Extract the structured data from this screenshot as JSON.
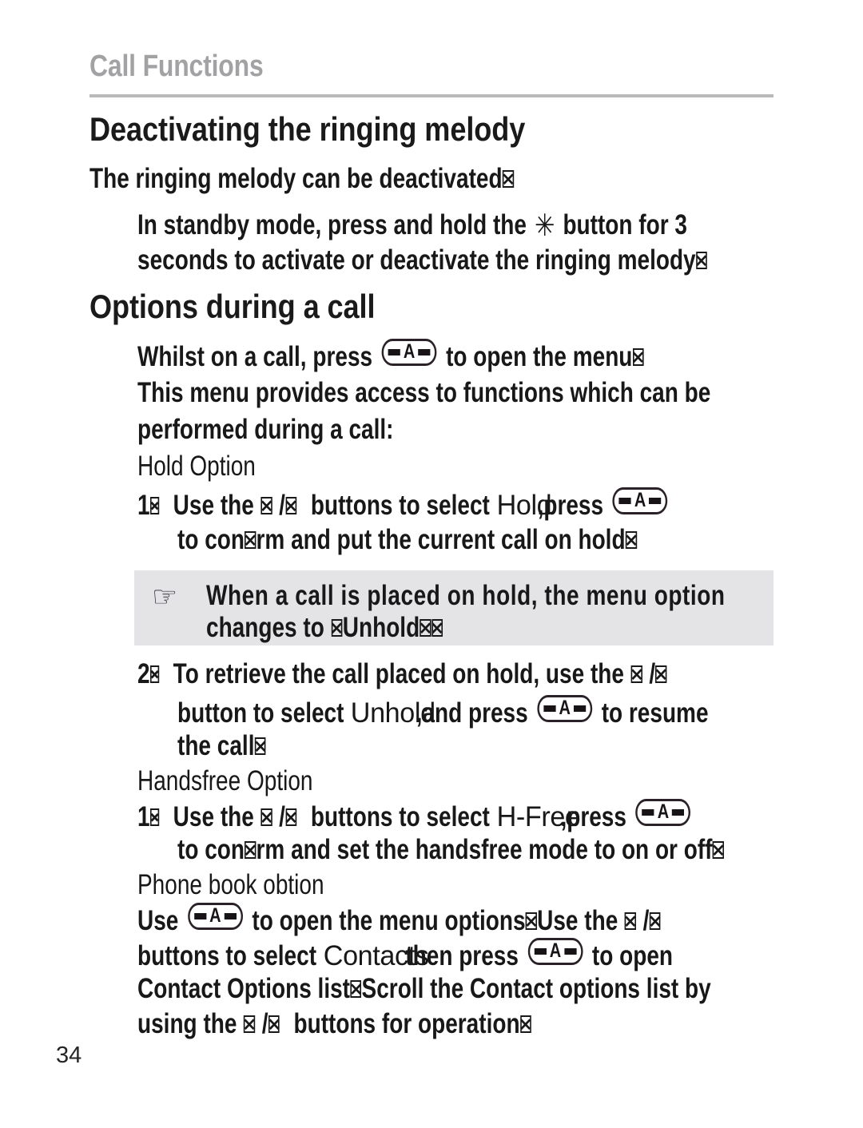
{
  "document": {
    "running_header": "Call Functions",
    "page_number": "34"
  },
  "sections": [
    {
      "heading": "Deactivating the ringing melody",
      "intro": "The ringing melody can be deactivated",
      "body_lines": [
        "In standby mode, press and hold the",
        "button for 3",
        "seconds to activate or deactivate the ringing melody"
      ]
    },
    {
      "heading": "Options during a call"
    }
  ],
  "text": {
    "deactivating_heading": "Deactivating the ringing melody",
    "intro_line": "The ringing melody can be deactivated",
    "standby_a": "In standby mode, press and hold the",
    "standby_b": "button for 3",
    "standby_c": "seconds to activate or deactivate the ringing melody",
    "options_heading": "Options during a call",
    "whilst_a": "Whilst on a call, press",
    "whilst_b": "to open the menu",
    "menu_access_1": "This menu provides access to functions which can be",
    "menu_access_2": "performed during a call:",
    "hold_option_title": "Hold Option",
    "hold_step_num": "1",
    "hold_step_a": "Use the",
    "hold_step_sep": "/",
    "hold_step_b": "buttons to select",
    "hold_label": "Hold",
    "hold_step_c": "press",
    "hold_step_d": "to confirm and put the current call on hold",
    "hold_step_d_pre": "to con",
    "hold_step_d_post": "rm and put the current call on hold",
    "retrieve_num": "2",
    "retrieve_a": "To retrieve the call placed on hold, use the",
    "retrieve_b": "button to select",
    "unhold_label": "Unhold",
    "retrieve_c": "and press",
    "retrieve_d": "to resume",
    "retrieve_e": "the call",
    "handsfree_title": "Handsfree Option",
    "handsfree_num": "1",
    "handsfree_a": "Use the",
    "handsfree_b": "buttons to select",
    "hfree_label": "H-Free",
    "handsfree_c": "press",
    "handsfree_d_pre": "to con",
    "handsfree_d_post": "rm and set the handsfree mode to on or off",
    "phonebook_title": "Phone book obtion",
    "phonebook_a": "Use",
    "phonebook_b": "to open the menu options",
    "phonebook_c": "Use the",
    "phonebook_d": "buttons to select",
    "contacts_label": "Contacts",
    "phonebook_e": "then press",
    "phonebook_f": "to open",
    "phonebook_g": "Contact Options list",
    "phonebook_h": "Scroll the Contact options list by",
    "phonebook_i": "using the",
    "phonebook_j": "buttons for operation"
  },
  "note": {
    "icon": "pointing-hand-icon",
    "line_1": "When a call is placed on hold, the menu option",
    "line_2_pre": "changes to",
    "line_2_label": "Unhold"
  },
  "icons": {
    "menu_key": "-A-",
    "menu_key_letter": "A",
    "star_button": "✳",
    "pointing_hand": "☞",
    "nav_arrow": "missing-glyph-box"
  },
  "colors": {
    "running_header": "#a2a2a4",
    "rule": "#b8b8ba",
    "body_text": "#181818",
    "note_background": "#e4e4e6",
    "page_background": "#ffffff"
  }
}
